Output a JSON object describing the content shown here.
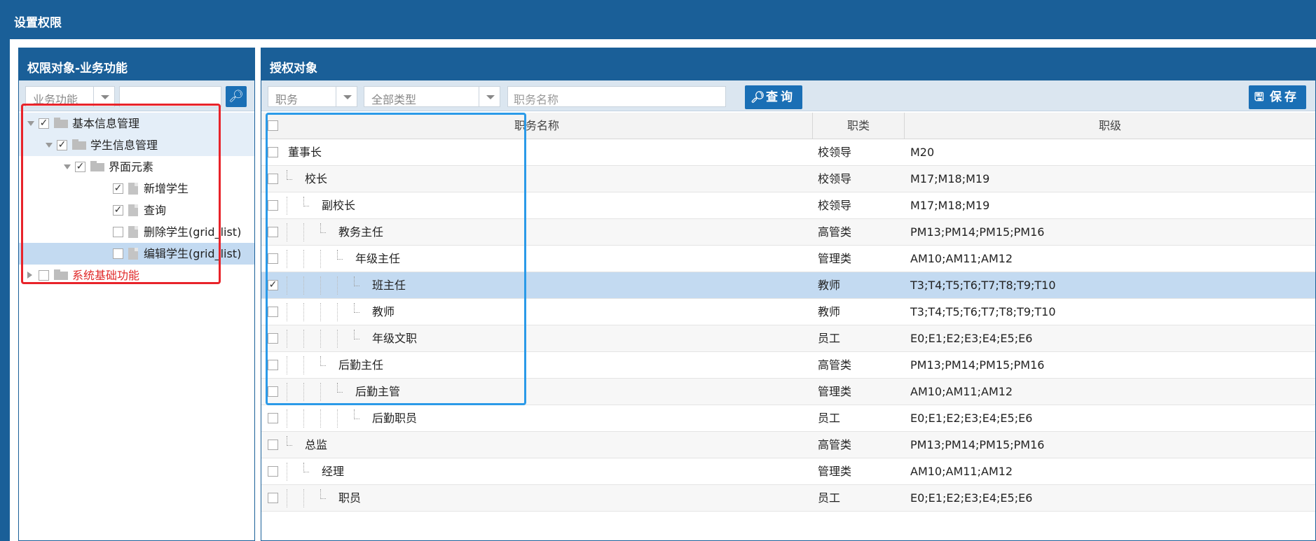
{
  "dialog": {
    "title": "设置权限"
  },
  "left": {
    "header": "权限对象-业务功能",
    "combo": "业务功能",
    "search_value": "",
    "search_icon": "magnifier-icon",
    "tree": [
      {
        "label": "基本信息管理",
        "checked": true,
        "kind": "folder",
        "expanded": true
      },
      {
        "label": "学生信息管理",
        "checked": true,
        "kind": "folder",
        "expanded": true
      },
      {
        "label": "界面元素",
        "checked": true,
        "kind": "folder",
        "expanded": true
      },
      {
        "label": "新增学生",
        "checked": true,
        "kind": "doc"
      },
      {
        "label": "查询",
        "checked": true,
        "kind": "doc"
      },
      {
        "label": "删除学生(grid_list)",
        "checked": false,
        "kind": "doc"
      },
      {
        "label": "编辑学生(grid_list)",
        "checked": false,
        "kind": "doc",
        "selected": true
      },
      {
        "label": "系统基础功能",
        "checked": false,
        "kind": "folder",
        "expanded": false,
        "color": "#e02828"
      }
    ]
  },
  "right": {
    "header": "授权对象",
    "combo1": "职务",
    "combo2": "全部类型",
    "name_placeholder": "职务名称",
    "query_label": "查询",
    "save_label": "保存",
    "columns": [
      "职务名称",
      "职类",
      "职级"
    ],
    "rows": [
      {
        "name": "董事长",
        "category": "校领导",
        "level": "M20",
        "depth": 0,
        "checked": false
      },
      {
        "name": "校长",
        "category": "校领导",
        "level": "M17;M18;M19",
        "depth": 1,
        "checked": false
      },
      {
        "name": "副校长",
        "category": "校领导",
        "level": "M17;M18;M19",
        "depth": 2,
        "checked": false
      },
      {
        "name": "教务主任",
        "category": "高管类",
        "level": "PM13;PM14;PM15;PM16",
        "depth": 3,
        "checked": false
      },
      {
        "name": "年级主任",
        "category": "管理类",
        "level": "AM10;AM11;AM12",
        "depth": 4,
        "checked": false
      },
      {
        "name": "班主任",
        "category": "教师",
        "level": "T3;T4;T5;T6;T7;T8;T9;T10",
        "depth": 5,
        "checked": true,
        "selected": true
      },
      {
        "name": "教师",
        "category": "教师",
        "level": "T3;T4;T5;T6;T7;T8;T9;T10",
        "depth": 5,
        "checked": false
      },
      {
        "name": "年级文职",
        "category": "员工",
        "level": "E0;E1;E2;E3;E4;E5;E6",
        "depth": 5,
        "checked": false
      },
      {
        "name": "后勤主任",
        "category": "高管类",
        "level": "PM13;PM14;PM15;PM16",
        "depth": 3,
        "checked": false
      },
      {
        "name": "后勤主管",
        "category": "管理类",
        "level": "AM10;AM11;AM12",
        "depth": 4,
        "checked": false
      },
      {
        "name": "后勤职员",
        "category": "员工",
        "level": "E0;E1;E2;E3;E4;E5;E6",
        "depth": 5,
        "checked": false
      },
      {
        "name": "总监",
        "category": "高管类",
        "level": "PM13;PM14;PM15;PM16",
        "depth": 1,
        "checked": false
      },
      {
        "name": "经理",
        "category": "管理类",
        "level": "AM10;AM11;AM12",
        "depth": 2,
        "checked": false
      },
      {
        "name": "职员",
        "category": "员工",
        "level": "E0;E1;E2;E3;E4;E5;E6",
        "depth": 3,
        "checked": false
      }
    ]
  },
  "colors": {
    "header_blue": "#1a5f98",
    "button_blue": "#1a6fb5",
    "highlight_red": "#e8232a",
    "highlight_blue": "#2b9ae8",
    "selected_row": "#c3daf1"
  }
}
